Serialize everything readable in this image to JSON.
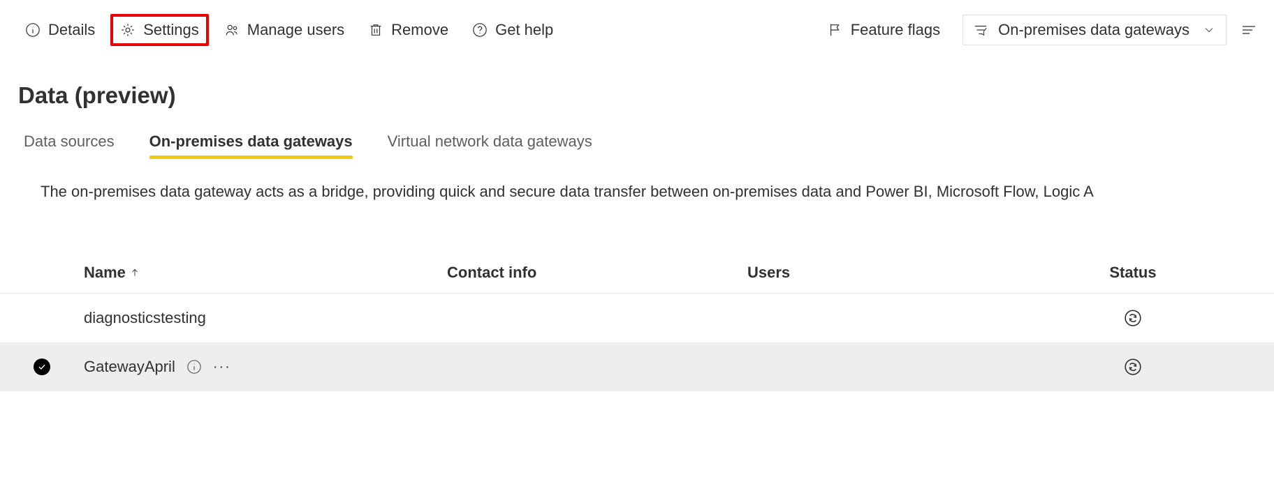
{
  "toolbar": {
    "details": "Details",
    "settings": "Settings",
    "manage_users": "Manage users",
    "remove": "Remove",
    "get_help": "Get help",
    "feature_flags": "Feature flags",
    "filter_label": "On-premises data gateways"
  },
  "page": {
    "title": "Data (preview)",
    "description": "The on-premises data gateway acts as a bridge, providing quick and secure data transfer between on-premises data and Power BI, Microsoft Flow, Logic A"
  },
  "tabs": {
    "data_sources": "Data sources",
    "on_prem": "On-premises data gateways",
    "vnet": "Virtual network data gateways"
  },
  "table": {
    "headers": {
      "name": "Name",
      "contact": "Contact info",
      "users": "Users",
      "status": "Status"
    },
    "rows": [
      {
        "name": "diagnosticstesting",
        "contact": "",
        "users": "",
        "selected": false,
        "has_info": false
      },
      {
        "name": "GatewayApril",
        "contact": "",
        "users": "",
        "selected": true,
        "has_info": true
      }
    ]
  }
}
